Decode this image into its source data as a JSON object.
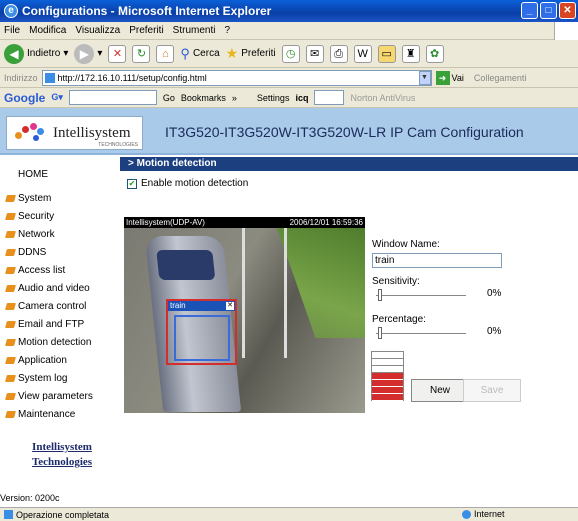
{
  "window": {
    "title": "Configurations - Microsoft Internet Explorer"
  },
  "menu": [
    "File",
    "Modifica",
    "Visualizza",
    "Preferiti",
    "Strumenti",
    "?"
  ],
  "toolbar": {
    "back": "Indietro",
    "search": "Cerca",
    "favorites": "Preferiti"
  },
  "address": {
    "label": "Indirizzo",
    "url": "http://172.16.10.111/setup/config.html",
    "go": "Vai",
    "links": "Collegamenti"
  },
  "googlebar": {
    "logo": "Google",
    "go": "Go",
    "bookmarks": "Bookmarks",
    "settings": "Settings",
    "icq": "icq",
    "norton": "Norton AntiVirus"
  },
  "header": {
    "logo": "Intellisystem",
    "logo_sub": "TECHNOLOGIES",
    "title": "IT3G520-IT3G520W-IT3G520W-LR IP Cam Configuration"
  },
  "sidebar": {
    "home": "HOME",
    "items": [
      "System",
      "Security",
      "Network",
      "DDNS",
      "Access list",
      "Audio and video",
      "Camera control",
      "Email and FTP",
      "Motion detection",
      "Application",
      "System log",
      "View parameters",
      "Maintenance"
    ],
    "company_line1": "Intellisystem",
    "company_line2": "Technologies",
    "version": "Version: 0200c"
  },
  "section": {
    "title": "> Motion detection"
  },
  "motion": {
    "enable_label": "Enable motion detection",
    "enabled": true,
    "video_source": "Intellisystem(UDP-AV)",
    "video_time": "2006/12/01 16:59:36",
    "window_label": "train",
    "window_name_label": "Window Name:",
    "window_name_value": "train",
    "sensitivity_label": "Sensitivity:",
    "sensitivity_value": "0%",
    "percentage_label": "Percentage:",
    "percentage_value": "0%",
    "new_label": "New",
    "save_label": "Save",
    "meter_color": "#d42d2d"
  },
  "status": {
    "text": "Operazione completata",
    "zone": "Internet"
  }
}
